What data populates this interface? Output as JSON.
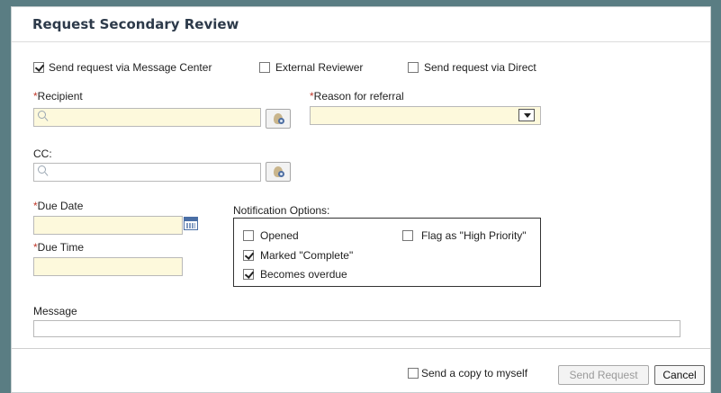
{
  "dialog": {
    "title": "Request Secondary Review"
  },
  "delivery": {
    "message_center": {
      "label": "Send request via Message Center",
      "checked": true
    },
    "external_reviewer": {
      "label": "External Reviewer",
      "checked": false
    },
    "direct": {
      "label": "Send request via Direct",
      "checked": false
    }
  },
  "recipient": {
    "required_mark": "*",
    "label": "Recipient",
    "value": ""
  },
  "reason": {
    "required_mark": "*",
    "label": "Reason for referral",
    "selected": ""
  },
  "cc": {
    "label": "CC:",
    "value": ""
  },
  "due_date": {
    "required_mark": "*",
    "label": "Due Date",
    "value": ""
  },
  "due_time": {
    "required_mark": "*",
    "label": "Due Time",
    "value": ""
  },
  "notification": {
    "label": "Notification Options:",
    "options": [
      {
        "label": "Opened",
        "checked": false
      },
      {
        "label": "Marked \"Complete\"",
        "checked": true
      },
      {
        "label": "Becomes overdue",
        "checked": true
      },
      {
        "label": "Flag as \"High Priority\"",
        "checked": false
      }
    ]
  },
  "message": {
    "label": "Message",
    "value": ""
  },
  "footer": {
    "copy_to_self": {
      "label": "Send a copy to myself",
      "checked": false
    },
    "send_label": "Send Request",
    "cancel_label": "Cancel"
  },
  "icons": {
    "lookup": "person-search-icon",
    "search": "search-icon",
    "calendar": "calendar-icon",
    "dropdown": "chevron-down-icon"
  },
  "colors": {
    "required": "#c0392b",
    "field_fill": "#fdf9dc",
    "background": "#5a7d83"
  }
}
